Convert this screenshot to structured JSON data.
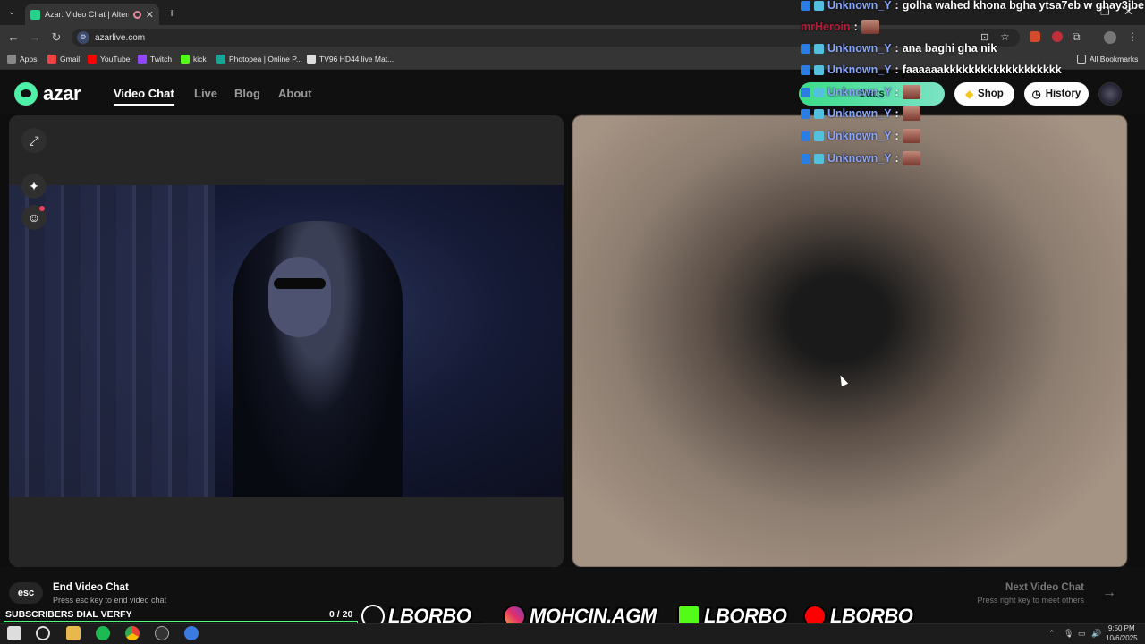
{
  "browser": {
    "tab_title": "Azar: Video Chat | Alternati",
    "url": "azarlive.com",
    "bookmarks": [
      "Apps",
      "Gmail",
      "YouTube",
      "Twitch",
      "kick",
      "Photopea | Online P...",
      "TV96 HD44 live Mat..."
    ],
    "all_bookmarks": "All Bookmarks"
  },
  "header": {
    "logo_text": "azar",
    "nav": [
      "Video Chat",
      "Live",
      "Blog",
      "About"
    ],
    "shop_label": "Shop",
    "history_label": "History",
    "stars_label": "Stars"
  },
  "chat": [
    {
      "user": "Unknown_Y",
      "text": "golha wahed khona bgha ytsa7eb w ghay3jbe"
    },
    {
      "user": "mrHeroin",
      "text": ""
    },
    {
      "user": "Unknown_Y",
      "text": "ana baghi gha nik"
    },
    {
      "user": "Unknown_Y",
      "text": "faaaaaakkkkkkkkkkkkkkkkkkk"
    },
    {
      "user": "Unknown_Y",
      "text": ""
    },
    {
      "user": "Unknown_Y",
      "text": ""
    },
    {
      "user": "Unknown_Y",
      "text": ""
    },
    {
      "user": "Unknown_Y",
      "text": ""
    }
  ],
  "bottom": {
    "esc_label": "esc",
    "end_title": "End Video Chat",
    "end_hint": "Press esc key to end video chat",
    "next_title": "Next Video Chat",
    "next_hint": "Press right key to meet others"
  },
  "overlay": {
    "subs_label": "SUBSCRIBERS DIAL VERFY",
    "subs_count": "0",
    "subs_goal": "/ 20",
    "socials": [
      "LBORBO_",
      "MOHCIN.AGM",
      "LBORBO",
      "LBORBO"
    ]
  },
  "taskbar": {
    "time": "9:50 PM",
    "date": "10/6/2025"
  },
  "colors": {
    "accent": "#4ef0a7",
    "chat_user": "#8aa6ff",
    "subs_bar": "#4cff7a"
  }
}
